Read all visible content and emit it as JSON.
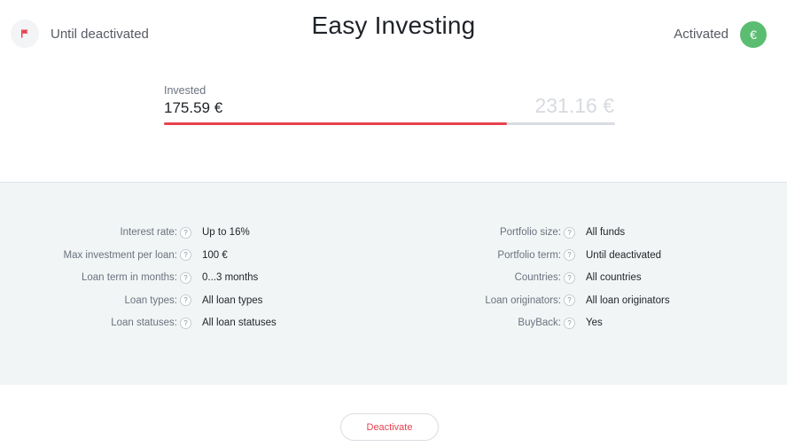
{
  "header": {
    "status_left": "Until deactivated",
    "title": "Easy Investing",
    "status_right": "Activated",
    "currency_symbol": "€"
  },
  "progress": {
    "label": "Invested",
    "invested": "175.59 €",
    "total": "231.16 €",
    "fraction": 0.76,
    "fill_color": "#e8424f"
  },
  "details": {
    "help_glyph": "?",
    "left": [
      {
        "label": "Interest rate:",
        "value": "Up to 16%"
      },
      {
        "label": "Max investment per loan:",
        "value": "100 €"
      },
      {
        "label": "Loan term in months:",
        "value": "0...3 months"
      },
      {
        "label": "Loan types:",
        "value": "All loan types"
      },
      {
        "label": "Loan statuses:",
        "value": "All loan statuses"
      }
    ],
    "right": [
      {
        "label": "Portfolio size:",
        "value": "All funds"
      },
      {
        "label": "Portfolio term:",
        "value": "Until deactivated"
      },
      {
        "label": "Countries:",
        "value": "All countries"
      },
      {
        "label": "Loan originators:",
        "value": "All loan originators"
      },
      {
        "label": "BuyBack:",
        "value": "Yes"
      }
    ]
  },
  "actions": {
    "deactivate_label": "Deactivate"
  },
  "colors": {
    "accent_red": "#e8424f",
    "success_green": "#5bbd72",
    "panel_bg": "#f1f5f5"
  },
  "icons": {
    "left": "flag-icon",
    "right": "euro-icon",
    "help": "question-icon"
  }
}
